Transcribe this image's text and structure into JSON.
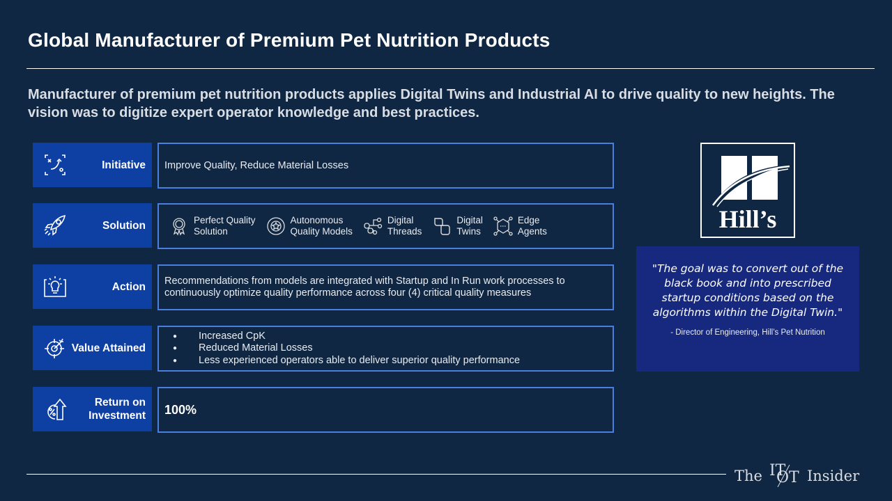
{
  "header": {
    "title": "Global Manufacturer of Premium Pet Nutrition Products",
    "subtitle": "Manufacturer of premium pet nutrition products applies Digital Twins and Industrial AI to drive quality to new heights. The vision was to digitize expert operator knowledge and best practices."
  },
  "rows": {
    "initiative": {
      "label": "Initiative",
      "icon": "strategy-board-icon",
      "text": "Improve Quality, Reduce Material Losses"
    },
    "solution": {
      "label": "Solution",
      "icon": "rocket-icon",
      "items": [
        {
          "icon": "award-ribbon-icon",
          "line1": "Perfect Quality",
          "line2": "Solution"
        },
        {
          "icon": "star-orbit-icon",
          "line1": "Autonomous",
          "line2": "Quality Models"
        },
        {
          "icon": "network-nodes-icon",
          "line1": "Digital",
          "line2": "Threads"
        },
        {
          "icon": "linked-shapes-icon",
          "line1": "Digital",
          "line2": "Twins"
        },
        {
          "icon": "hexagon-network-icon",
          "line1": "Edge",
          "line2": "Agents"
        }
      ]
    },
    "action": {
      "label": "Action",
      "icon": "lightbulb-icon",
      "text": "Recommendations from models are integrated with Startup and In Run work processes to continuously optimize quality performance across four (4) critical quality measures"
    },
    "value": {
      "label": "Value Attained",
      "icon": "target-arrow-icon",
      "bullets": [
        "Increased CpK",
        "Reduced Material Losses",
        "Less experienced operators able to deliver superior quality performance"
      ]
    },
    "roi": {
      "label": "Return on Investment",
      "icon": "percent-growth-icon",
      "text": "100%"
    }
  },
  "logo": {
    "text": "Hill’s"
  },
  "quote": {
    "text": "\"The goal was to convert out of the black book and into prescribed startup conditions based on the algorithms within the Digital Twin.\"",
    "attribution": "- Director of Engineering, Hill’s Pet Nutrition"
  },
  "footer": {
    "brand_left": "The",
    "brand_it": "IT",
    "brand_ot": "OT",
    "brand_right": "Insider"
  },
  "colors": {
    "background": "#0f2743",
    "label_blue": "#0e3fa3",
    "box_border": "#4a7fe0",
    "quote_bg": "#16297e"
  }
}
